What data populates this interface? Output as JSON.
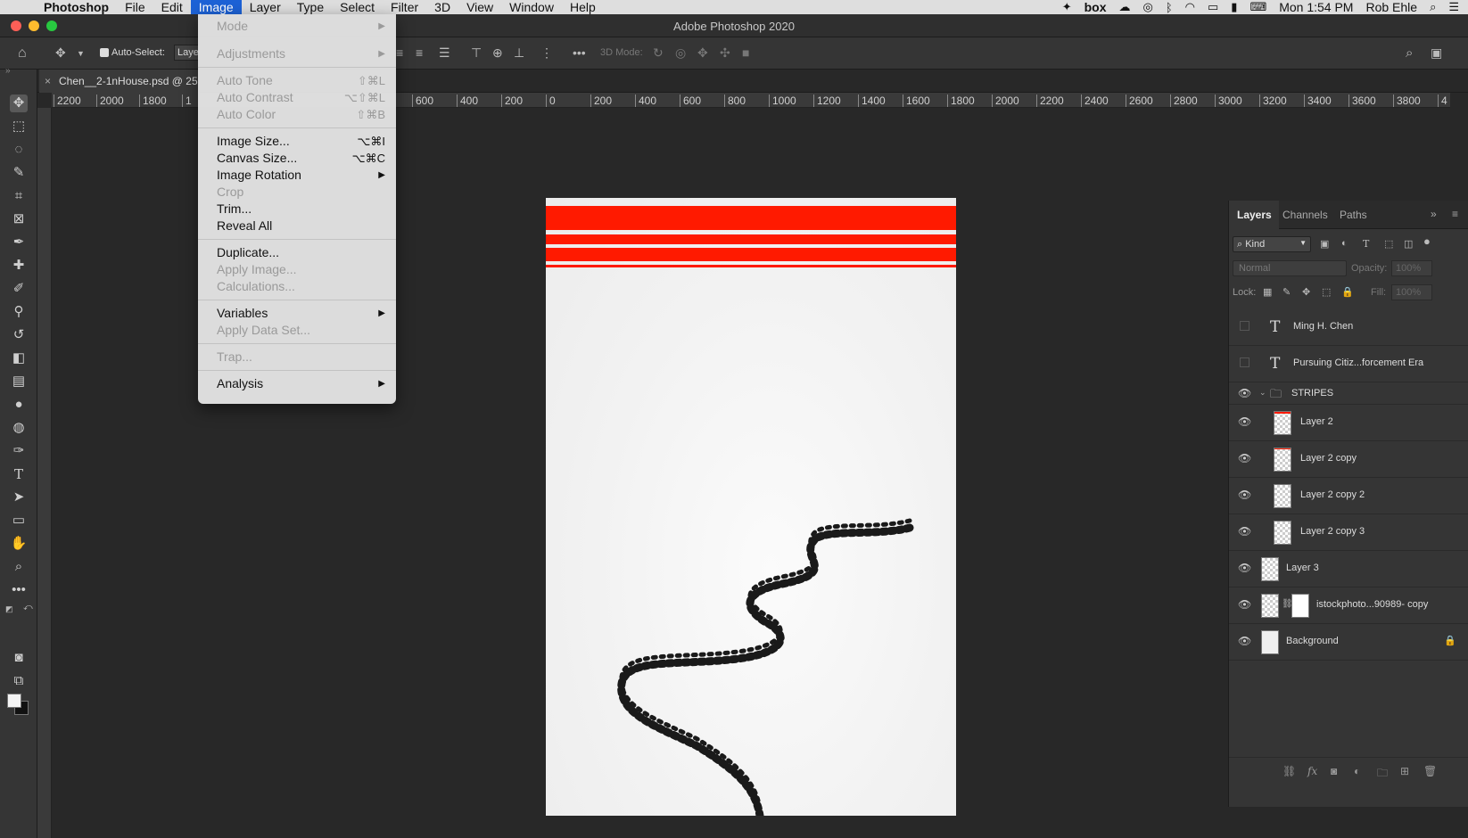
{
  "menubar": {
    "app_name": "Photoshop",
    "items": [
      "File",
      "Edit",
      "Image",
      "Layer",
      "Type",
      "Select",
      "Filter",
      "3D",
      "View",
      "Window",
      "Help"
    ],
    "active_item": "Image",
    "clock": "Mon 1:54 PM",
    "user": "Rob Ehle",
    "box_label": "box"
  },
  "window": {
    "title": "Adobe Photoshop 2020"
  },
  "options_bar": {
    "auto_select_label": "Auto-Select:",
    "auto_select_value": "Laye",
    "mode_3d_label": "3D Mode:"
  },
  "document": {
    "tab_name": "Chen__2-1nHouse.psd @ 25"
  },
  "ruler": {
    "left_ticks": [
      "2200",
      "2000",
      "1800",
      "1"
    ],
    "right_ticks": [
      "600",
      "400",
      "200",
      "0",
      "200",
      "400",
      "600",
      "800",
      "1000",
      "1200",
      "1400",
      "1600",
      "1800",
      "2000",
      "2200",
      "2400",
      "2600",
      "2800",
      "3000",
      "3200",
      "3400",
      "3600",
      "3800",
      "4"
    ]
  },
  "image_menu": {
    "groups": [
      [
        {
          "label": "Mode",
          "shortcut": "",
          "submenu": true,
          "disabled": true
        },
        {
          "label": "Adjustments",
          "shortcut": "",
          "submenu": true,
          "disabled": true
        }
      ],
      [
        {
          "label": "Auto Tone",
          "shortcut": "⇧⌘L",
          "submenu": false,
          "disabled": true
        },
        {
          "label": "Auto Contrast",
          "shortcut": "⌥⇧⌘L",
          "submenu": false,
          "disabled": true
        },
        {
          "label": "Auto Color",
          "shortcut": "⇧⌘B",
          "submenu": false,
          "disabled": true
        }
      ],
      [
        {
          "label": "Image Size...",
          "shortcut": "⌥⌘I",
          "submenu": false,
          "disabled": false
        },
        {
          "label": "Canvas Size...",
          "shortcut": "⌥⌘C",
          "submenu": false,
          "disabled": false
        },
        {
          "label": "Image Rotation",
          "shortcut": "",
          "submenu": true,
          "disabled": false
        },
        {
          "label": "Crop",
          "shortcut": "",
          "submenu": false,
          "disabled": true
        },
        {
          "label": "Trim...",
          "shortcut": "",
          "submenu": false,
          "disabled": false
        },
        {
          "label": "Reveal All",
          "shortcut": "",
          "submenu": false,
          "disabled": false
        }
      ],
      [
        {
          "label": "Duplicate...",
          "shortcut": "",
          "submenu": false,
          "disabled": false
        },
        {
          "label": "Apply Image...",
          "shortcut": "",
          "submenu": false,
          "disabled": true
        },
        {
          "label": "Calculations...",
          "shortcut": "",
          "submenu": false,
          "disabled": true
        }
      ],
      [
        {
          "label": "Variables",
          "shortcut": "",
          "submenu": true,
          "disabled": false
        },
        {
          "label": "Apply Data Set...",
          "shortcut": "",
          "submenu": false,
          "disabled": true
        }
      ],
      [
        {
          "label": "Trap...",
          "shortcut": "",
          "submenu": false,
          "disabled": true
        }
      ],
      [
        {
          "label": "Analysis",
          "shortcut": "",
          "submenu": true,
          "disabled": false
        }
      ]
    ]
  },
  "layers_panel": {
    "tabs": [
      "Layers",
      "Channels",
      "Paths"
    ],
    "active_tab": "Layers",
    "filter_kind": "Kind",
    "blend_mode": "Normal",
    "opacity_label": "Opacity:",
    "opacity_value": "100%",
    "lock_label": "Lock:",
    "fill_label": "Fill:",
    "fill_value": "100%",
    "layers": [
      {
        "name": "Ming H. Chen",
        "kind": "text",
        "visible": false,
        "indent": 0
      },
      {
        "name": "Pursuing  Citiz...forcement Era",
        "kind": "text",
        "visible": false,
        "indent": 0
      },
      {
        "name": "STRIPES",
        "kind": "group",
        "visible": true,
        "indent": 0
      },
      {
        "name": "Layer 2",
        "kind": "pixel-stripe",
        "visible": true,
        "indent": 1
      },
      {
        "name": "Layer 2 copy",
        "kind": "pixel-stripe",
        "visible": true,
        "indent": 1
      },
      {
        "name": "Layer 2 copy 2",
        "kind": "pixel",
        "visible": true,
        "indent": 1
      },
      {
        "name": "Layer 2 copy 3",
        "kind": "pixel",
        "visible": true,
        "indent": 1
      },
      {
        "name": "Layer 3",
        "kind": "pixel",
        "visible": true,
        "indent": 0
      },
      {
        "name": "istockphoto...90989- copy",
        "kind": "masked",
        "visible": true,
        "indent": 0
      },
      {
        "name": "Background",
        "kind": "background",
        "visible": true,
        "indent": 0,
        "locked": true
      }
    ]
  },
  "colors": {
    "accent_menu": "#1d62d6",
    "stripe_red": "#ff1a00"
  }
}
